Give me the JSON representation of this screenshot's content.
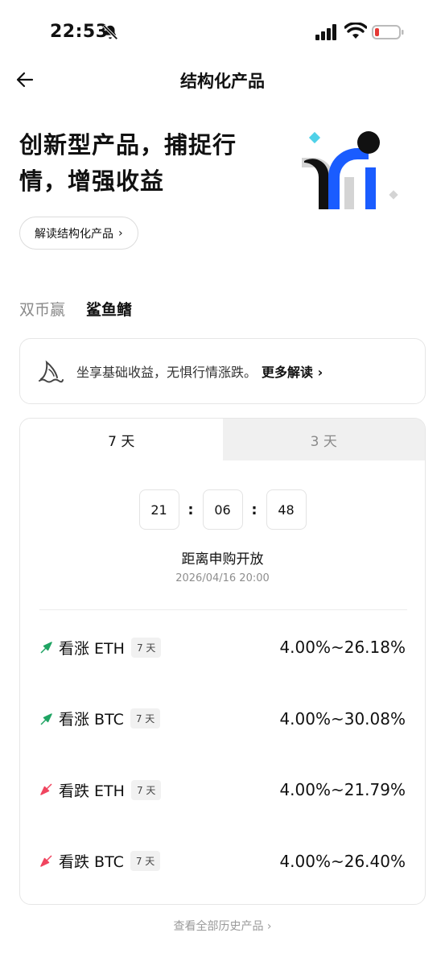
{
  "status_bar": {
    "time": "22:53",
    "icons": [
      "bell-off-icon",
      "signal-icon",
      "wifi-icon",
      "battery-low-icon"
    ],
    "battery_color": "#e53935"
  },
  "nav": {
    "back_icon": "arrow-left-icon",
    "title": "结构化产品"
  },
  "hero": {
    "title_line1": "创新型产品，捕捉行",
    "title_line2": "情，增强收益",
    "explain_button": "解读结构化产品",
    "explain_chevron": "›",
    "illustration": "chart-illustration"
  },
  "type_tabs": [
    {
      "label": "双币赢",
      "active": false
    },
    {
      "label": "鲨鱼鳍",
      "active": true
    }
  ],
  "info_card": {
    "icon": "shark-fin-icon",
    "text": "坐享基础收益，无惧行情涨跌。",
    "more_label": "更多解读",
    "more_chevron": "›"
  },
  "period_tabs": [
    {
      "label": "7 天",
      "active": true
    },
    {
      "label": "3 天",
      "active": false
    }
  ],
  "countdown": {
    "hours": "21",
    "minutes": "06",
    "seconds": "48",
    "separator": ":",
    "label": "距离申购开放",
    "date": "2026/04/16 20:00"
  },
  "products": [
    {
      "direction": "up",
      "name": "看涨 ETH",
      "period": "7 天",
      "rate": "4.00%~26.18%"
    },
    {
      "direction": "up",
      "name": "看涨 BTC",
      "period": "7 天",
      "rate": "4.00%~30.08%"
    },
    {
      "direction": "down",
      "name": "看跌 ETH",
      "period": "7 天",
      "rate": "4.00%~21.79%"
    },
    {
      "direction": "down",
      "name": "看跌 BTC",
      "period": "7 天",
      "rate": "4.00%~26.40%"
    }
  ],
  "colors": {
    "up": "#1fa463",
    "down": "#f0455f",
    "accent_blue": "#1a5cff",
    "diamond_cyan": "#4fd1e8"
  },
  "history_link": "查看全部历史产品 ›"
}
